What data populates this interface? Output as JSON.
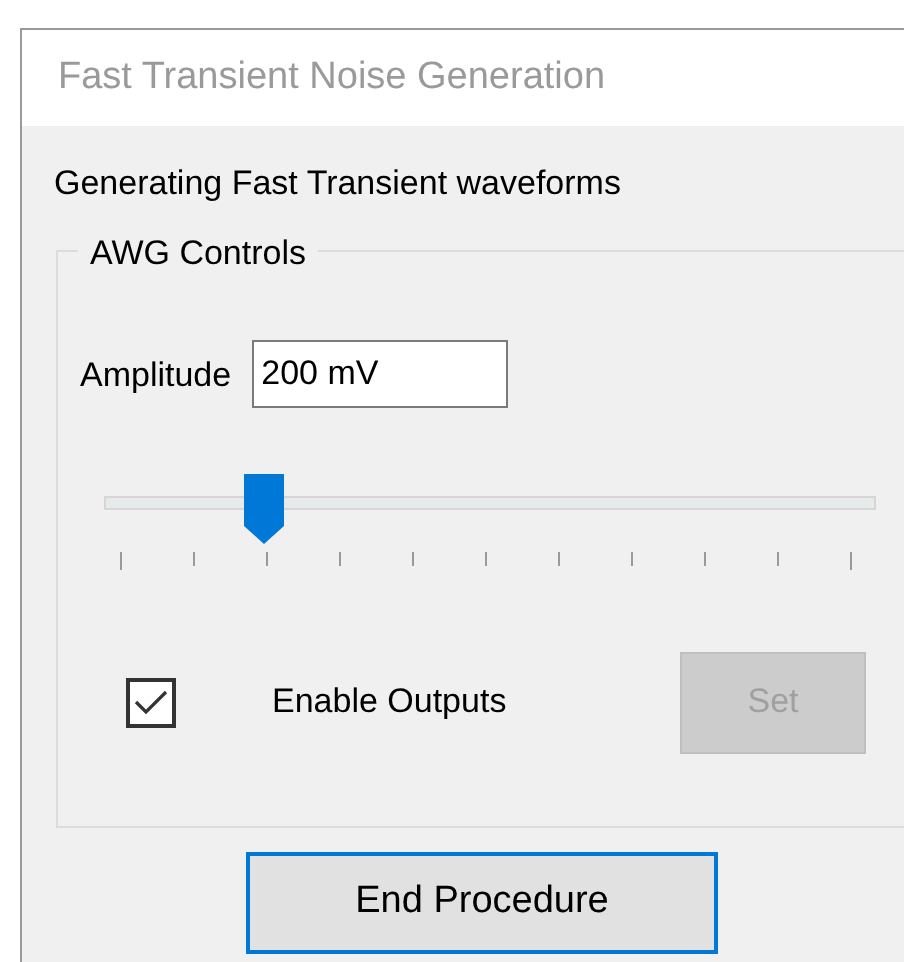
{
  "window": {
    "title": "Fast Transient Noise Generation"
  },
  "status_text": "Generating Fast Transient waveforms",
  "group": {
    "title": "AWG Controls",
    "amplitude": {
      "label": "Amplitude",
      "value": "200 mV"
    },
    "slider": {
      "level": 0.2
    },
    "enable_outputs": {
      "label": "Enable Outputs",
      "checked": true
    },
    "set_button": {
      "label": "Set",
      "disabled": true
    }
  },
  "end_button": {
    "label": "End Procedure",
    "focused": true
  }
}
